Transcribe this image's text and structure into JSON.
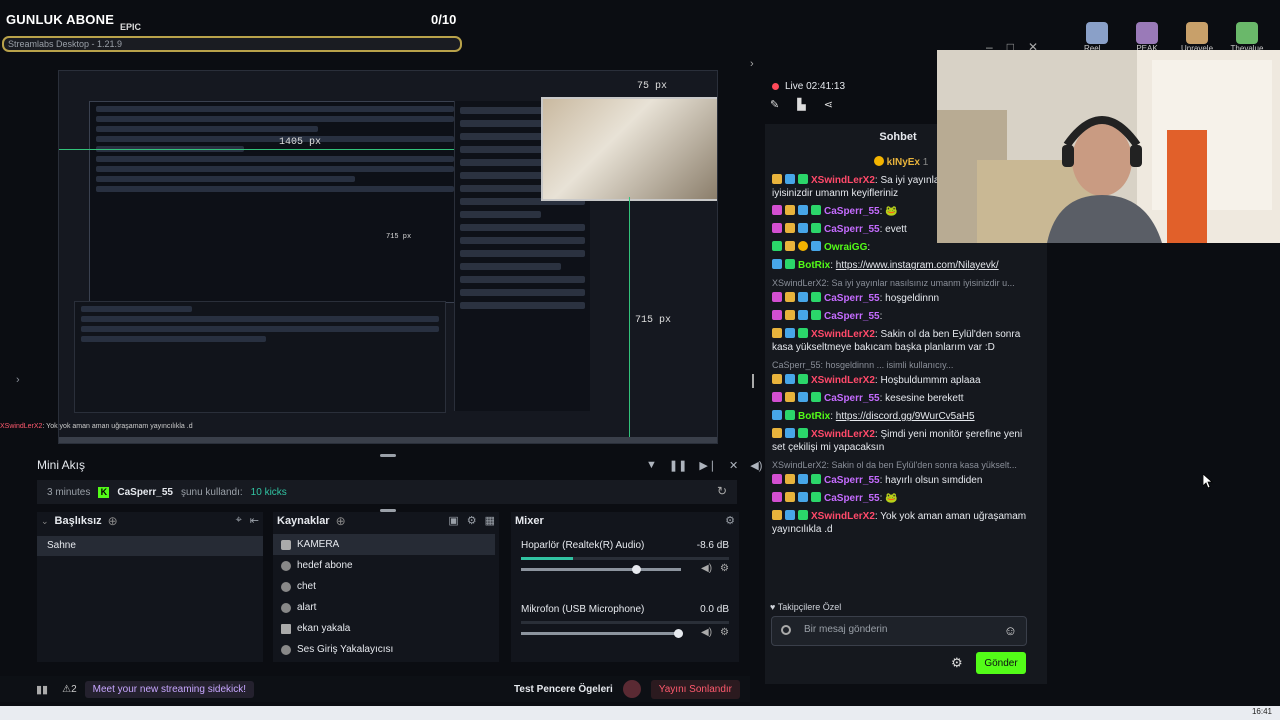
{
  "overlay": {
    "goal_title": "GUNLUK ABONE",
    "goal_count": "0/10",
    "goal_progress": 0,
    "app_title": "Streamlabs Desktop - 1.21.9",
    "epic_label": "EPIC"
  },
  "preview": {
    "width_label": "1405 px",
    "height_label_1": "715 px",
    "height_label_2": "715 px",
    "cam_label": "75 px"
  },
  "mini_feed": {
    "title": "Mini Akış",
    "event": {
      "time": "3 minutes",
      "user": "CaSperr_55",
      "action": "şunu kullandı:",
      "value": "10 kicks"
    }
  },
  "scenes": {
    "title": "Başlıksız",
    "items": [
      "Sahne"
    ]
  },
  "sources": {
    "title": "Kaynaklar",
    "items": [
      {
        "label": "KAMERA",
        "icon": "camera-icon"
      },
      {
        "label": "hedef abone",
        "icon": "globe-icon"
      },
      {
        "label": "chet",
        "icon": "globe-icon"
      },
      {
        "label": "alart",
        "icon": "globe-icon"
      },
      {
        "label": "ekan yakala",
        "icon": "monitor-icon"
      },
      {
        "label": "Ses Giriş Yakalayıcısı",
        "icon": "audio-input-icon"
      }
    ]
  },
  "mixer": {
    "title": "Mixer",
    "channels": [
      {
        "name": "Hoparlör (Realtek(R) Audio)",
        "db": "-8.6 dB",
        "level": 0.72,
        "meter": 0.25
      },
      {
        "name": "Mikrofon (USB Microphone)",
        "db": "0.0 dB",
        "level": 0.98,
        "meter": 0.0
      }
    ]
  },
  "footer": {
    "badge_count": "2",
    "promo": "Meet your new streaming sidekick!",
    "test_windows": "Test Pencere Ögeleri",
    "go_live": "Yayını Sonlandır"
  },
  "chat": {
    "live_label": "Live 02:41:13",
    "title": "Sohbet",
    "pinned_user": "kINyEx",
    "pinned_count": "1",
    "messages": [
      {
        "type": "msg",
        "badges": [
          "b-crown",
          "b-sub",
          "b-mod"
        ],
        "name": "XSwindLerX2",
        "color": "#ff4a6a",
        "text": "Sa iyi yayınlar nasılsınız umanm iyisinizdir umanm keyifleriniz"
      },
      {
        "type": "msg",
        "badges": [
          "b-vip",
          "b-crown",
          "b-sub",
          "b-mod"
        ],
        "name": "CaSperr_55",
        "color": "#c56cff",
        "text": "🐸"
      },
      {
        "type": "msg",
        "badges": [
          "b-vip",
          "b-crown",
          "b-sub",
          "b-mod"
        ],
        "name": "CaSperr_55",
        "color": "#c56cff",
        "text": "evett"
      },
      {
        "type": "msg",
        "badges": [
          "b-mod",
          "b-crown",
          "b-gold",
          "b-sub"
        ],
        "name": "OwraiGG",
        "color": "#53fc18",
        "text": ""
      },
      {
        "type": "msg",
        "badges": [
          "b-sub",
          "b-mod"
        ],
        "name": "BotRix",
        "color": "#53fc18",
        "text": "",
        "link": "https://www.instagram.com/Nilayevk/"
      },
      {
        "type": "reply",
        "text": "XSwindLerX2: Sa iyi yayınlar nasılsınız umanm iyisinizdir u..."
      },
      {
        "type": "msg",
        "badges": [
          "b-vip",
          "b-crown",
          "b-sub",
          "b-mod"
        ],
        "name": "CaSperr_55",
        "color": "#c56cff",
        "text": "hoşgeldinnn"
      },
      {
        "type": "msg",
        "badges": [
          "b-vip",
          "b-crown",
          "b-sub",
          "b-mod"
        ],
        "name": "CaSperr_55",
        "color": "#c56cff",
        "text": ""
      },
      {
        "type": "msg",
        "badges": [
          "b-crown",
          "b-sub",
          "b-mod"
        ],
        "name": "XSwindLerX2",
        "color": "#ff4a6a",
        "text": "Sakin ol da ben Eylül'den sonra kasa yükseltmeye bakıcam başka planlarım var :D"
      },
      {
        "type": "reply",
        "text": "CaSperr_55: hosgeldinnn ... isimli kullanıcıy..."
      },
      {
        "type": "msg",
        "badges": [
          "b-crown",
          "b-sub",
          "b-mod"
        ],
        "name": "XSwindLerX2",
        "color": "#ff4a6a",
        "text": "Hoşbuldummm aplaaa"
      },
      {
        "type": "msg",
        "badges": [
          "b-vip",
          "b-crown",
          "b-sub",
          "b-mod"
        ],
        "name": "CaSperr_55",
        "color": "#c56cff",
        "text": "kesesine berekett"
      },
      {
        "type": "msg",
        "badges": [
          "b-sub",
          "b-mod"
        ],
        "name": "BotRix",
        "color": "#53fc18",
        "text": "",
        "link": "https://discord.gg/9WurCv5aH5"
      },
      {
        "type": "msg",
        "badges": [
          "b-crown",
          "b-sub",
          "b-mod"
        ],
        "name": "XSwindLerX2",
        "color": "#ff4a6a",
        "text": "Şimdi yeni monitör şerefine yeni set çekilişi mi yapacaksın"
      },
      {
        "type": "reply",
        "text": "XSwindLerX2: Sakin ol da ben Eylül'den sonra kasa yükselt..."
      },
      {
        "type": "msg",
        "badges": [
          "b-vip",
          "b-crown",
          "b-sub",
          "b-mod"
        ],
        "name": "CaSperr_55",
        "color": "#c56cff",
        "text": "hayırlı olsun sımdiden"
      },
      {
        "type": "msg",
        "badges": [
          "b-vip",
          "b-crown",
          "b-sub",
          "b-mod"
        ],
        "name": "CaSperr_55",
        "color": "#c56cff",
        "text": "🐸"
      },
      {
        "type": "msg",
        "badges": [
          "b-crown",
          "b-sub",
          "b-mod"
        ],
        "name": "XSwindLerX2",
        "color": "#ff4a6a",
        "text": "Yok yok aman aman uğraşamam yayıncılıkla .d"
      }
    ],
    "followers_only": "Takipçilere Özel",
    "input_placeholder": "Bir mesaj gönderin",
    "send_label": "Gönder"
  },
  "desktop": {
    "icons": [
      {
        "label": "Reel ka",
        "color": "#8aa0c8"
      },
      {
        "label": "PEAK",
        "color": "#9a7ab8"
      },
      {
        "label": "Unravele",
        "color": "#c8a06a"
      },
      {
        "label": "Thevalue",
        "color": "#6ab86a"
      }
    ],
    "clock": "16:41"
  },
  "strip_text": {
    "name": "XSwindLerX2",
    "text": ": Yok yok aman aman uğraşamam yayıncılıkla .d"
  }
}
